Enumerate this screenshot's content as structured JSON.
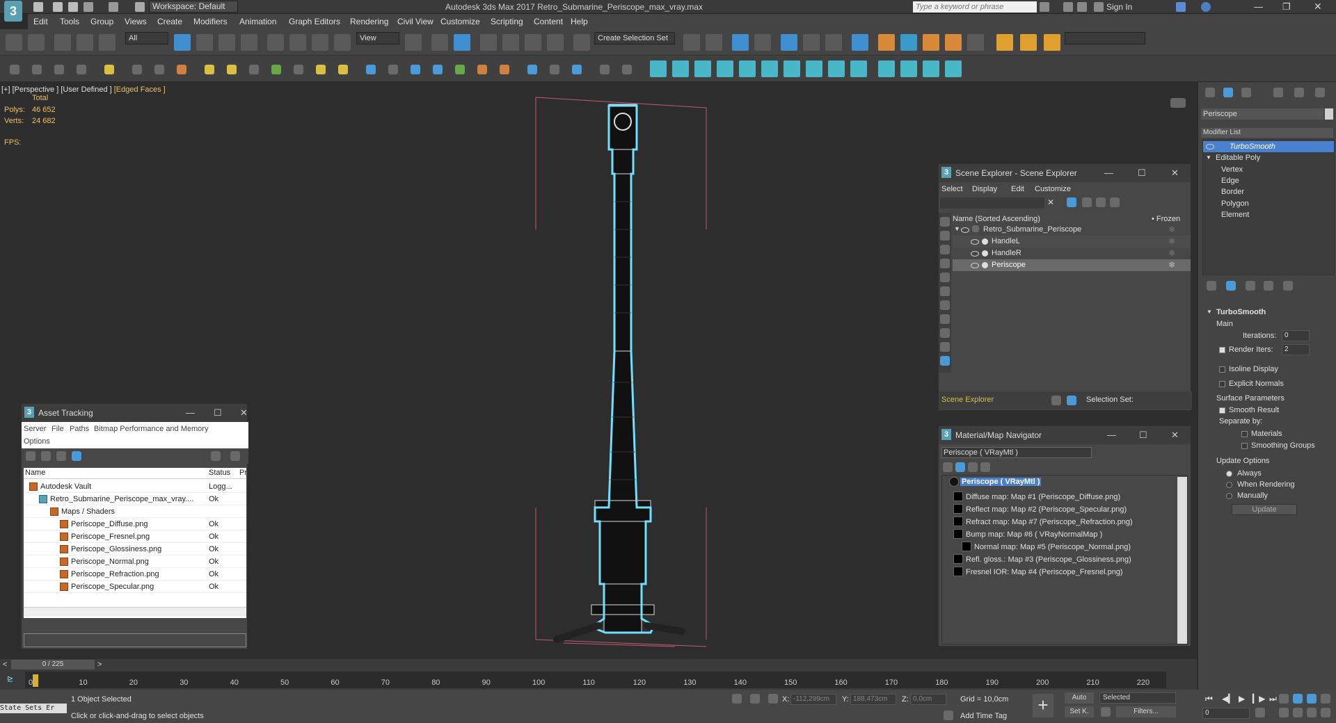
{
  "title_bar": {
    "workspace": "Workspace: Default",
    "app_title": "Autodesk 3ds Max 2017    Retro_Submarine_Periscope_max_vray.max",
    "search_placeholder": "Type a keyword or phrase",
    "sign_in": "Sign In"
  },
  "menu": [
    "Edit",
    "Tools",
    "Group",
    "Views",
    "Create",
    "Modifiers",
    "Animation",
    "Graph Editors",
    "Rendering",
    "Civil View",
    "Customize",
    "Scripting",
    "Content",
    "Help"
  ],
  "toolbar": {
    "filter_dropdown": "All",
    "view_dropdown": "View",
    "selection_set": "Create Selection Set"
  },
  "viewport": {
    "label_plus": "[+]",
    "label_view": "[Perspective ]",
    "label_user": "[User Defined ]",
    "label_edged": "[Edged Faces ]",
    "stats_total": "Total",
    "polys_label": "Polys:",
    "polys_value": "46 652",
    "verts_label": "Verts:",
    "verts_value": "24 682",
    "fps_label": "FPS:"
  },
  "asset_tracking": {
    "title": "Asset Tracking",
    "menu": [
      "Server",
      "File",
      "Paths",
      "Bitmap Performance and Memory",
      "Options"
    ],
    "col_name": "Name",
    "col_status": "Status",
    "col_p": "Pr",
    "rows": [
      {
        "name": "Autodesk Vault",
        "status": "Logg..."
      },
      {
        "name": "Retro_Submarine_Periscope_max_vray....",
        "status": "Ok"
      },
      {
        "name": "Maps / Shaders",
        "status": ""
      },
      {
        "name": "Periscope_Diffuse.png",
        "status": "Ok"
      },
      {
        "name": "Periscope_Fresnel.png",
        "status": "Ok"
      },
      {
        "name": "Periscope_Glossiness.png",
        "status": "Ok"
      },
      {
        "name": "Periscope_Normal.png",
        "status": "Ok"
      },
      {
        "name": "Periscope_Refraction.png",
        "status": "Ok"
      },
      {
        "name": "Periscope_Specular.png",
        "status": "Ok"
      }
    ]
  },
  "scene_explorer": {
    "title": "Scene Explorer - Scene Explorer",
    "menu": [
      "Select",
      "Display",
      "Edit",
      "Customize"
    ],
    "col_name": "Name (Sorted Ascending)",
    "col_frozen": "• Frozen",
    "items": [
      "Retro_Submarine_Periscope",
      "HandleL",
      "HandleR",
      "Periscope"
    ],
    "footer_left": "Scene Explorer",
    "footer_right": "Selection Set:"
  },
  "material_navigator": {
    "title": "Material/Map Navigator",
    "field": "Periscope  ( VRayMtl )",
    "root": "Periscope  ( VRayMtl )",
    "maps": [
      "Diffuse map: Map #1 (Periscope_Diffuse.png)",
      "Reflect map: Map #2 (Periscope_Specular.png)",
      "Refract map: Map #7 (Periscope_Refraction.png)",
      "Bump map: Map #6  ( VRayNormalMap )",
      "Normal map: Map #5 (Periscope_Normal.png)",
      "Refl. gloss.: Map #3 (Periscope_Glossiness.png)",
      "Fresnel IOR: Map #4 (Periscope_Fresnel.png)"
    ]
  },
  "command_panel": {
    "object_name": "Periscope",
    "modifier_list": "Modifier List",
    "stack": [
      "TurboSmooth",
      "Editable Poly",
      "Vertex",
      "Edge",
      "Border",
      "Polygon",
      "Element"
    ],
    "rollout_title": "TurboSmooth",
    "main": "Main",
    "iterations_label": "Iterations:",
    "iterations_value": "0",
    "render_iters_label": "Render Iters:",
    "render_iters_value": "2",
    "isoline": "Isoline Display",
    "explicit": "Explicit Normals",
    "surface_params": "Surface Parameters",
    "smooth_result": "Smooth Result",
    "separate_by": "Separate by:",
    "materials": "Materials",
    "smoothing_groups": "Smoothing Groups",
    "update_options": "Update Options",
    "always": "Always",
    "when_rendering": "When Rendering",
    "manually": "Manually",
    "update_button": "Update"
  },
  "timeline": {
    "frame": "0 / 225",
    "ticks": [
      "0",
      "10",
      "20",
      "30",
      "40",
      "50",
      "60",
      "70",
      "80",
      "90",
      "100",
      "110",
      "120",
      "130",
      "140",
      "150",
      "160",
      "170",
      "180",
      "190",
      "200",
      "210",
      "220"
    ]
  },
  "status": {
    "state_sets": "State Sets Er",
    "selected": "1 Object Selected",
    "prompt": "Click or click-and-drag to select objects",
    "x_label": "X:",
    "x_value": "-112,299cm",
    "y_label": "Y:",
    "y_value": "188,473cm",
    "z_label": "Z:",
    "z_value": "0,0cm",
    "grid": "Grid = 10,0cm",
    "add_time_tag": "Add Time Tag",
    "auto": "Auto",
    "set_k": "Set K.",
    "selected_drop": "Selected",
    "filters": "Filters...",
    "frame_field": "0"
  }
}
